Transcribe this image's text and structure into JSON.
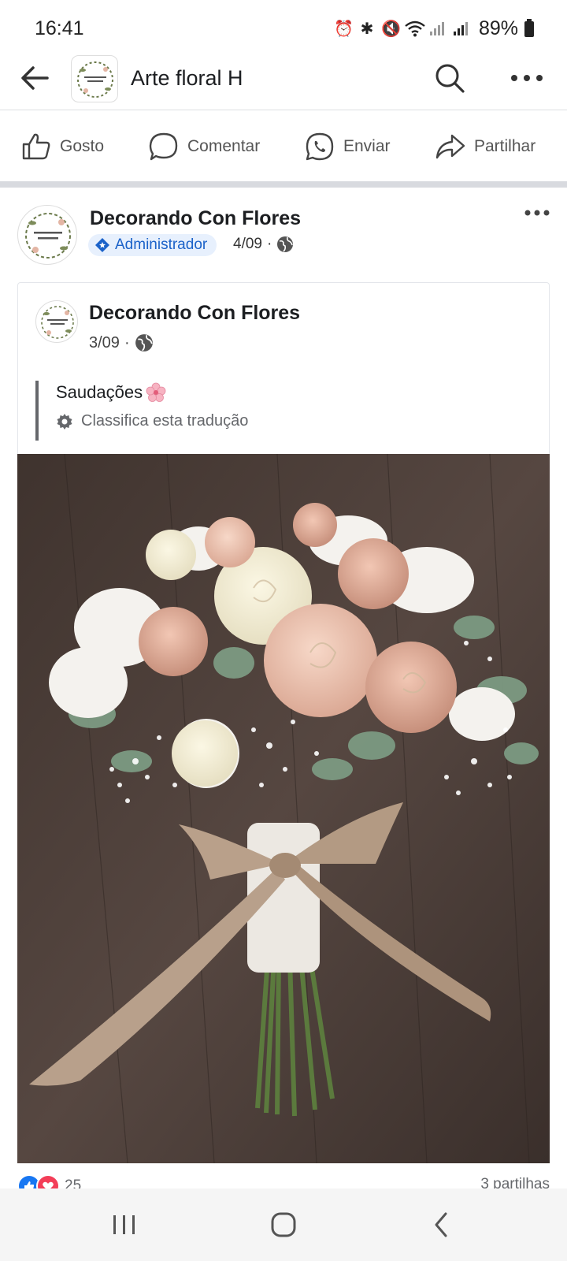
{
  "status": {
    "time": "16:41",
    "battery": "89%"
  },
  "header": {
    "title": "Arte floral H"
  },
  "actions": {
    "like": "Gosto",
    "comment": "Comentar",
    "send": "Enviar",
    "share": "Partilhar"
  },
  "post": {
    "author": "Decorando Con Flores",
    "role": "Administrador",
    "date": "4/09",
    "shared": {
      "author": "Decorando Con Flores",
      "date": "3/09",
      "text": "Saudações",
      "rate_translation": "Classifica esta tradução"
    },
    "reactions_count": "25",
    "shares": "3 partilhas"
  },
  "icons": {
    "back": "arrow-left-icon",
    "search": "search-icon",
    "more": "more-horizontal-icon",
    "like": "thumbs-up-icon",
    "comment": "speech-bubble-icon",
    "send": "whatsapp-icon",
    "share": "share-arrow-icon",
    "globe": "globe-icon",
    "gear": "gear-icon",
    "flower_emoji": "cherry-blossom-emoji"
  },
  "colors": {
    "facebook_blue": "#1877f2",
    "love_red": "#f33e58",
    "admin_badge_bg": "#e7f0fd",
    "admin_badge_text": "#1b62c9"
  }
}
